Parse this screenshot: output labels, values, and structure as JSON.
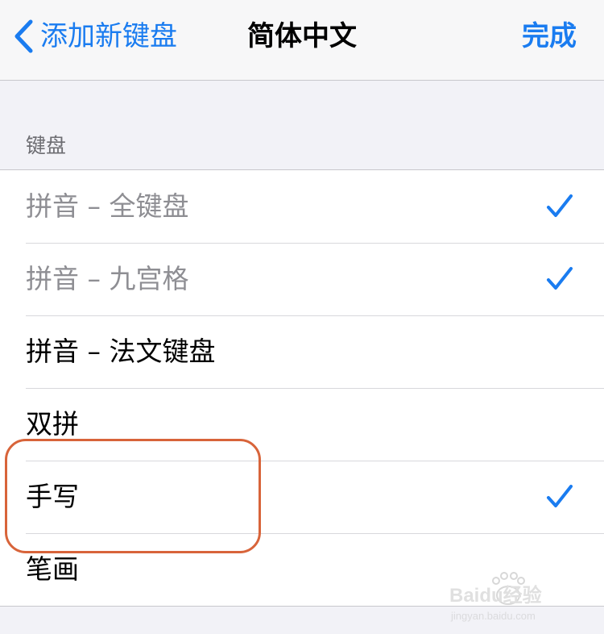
{
  "navbar": {
    "back_label": "添加新键盘",
    "title": "简体中文",
    "done_label": "完成"
  },
  "section": {
    "header": "键盘"
  },
  "keyboards": [
    {
      "label": "拼音 – 全键盘",
      "checked": true,
      "dimmed": true
    },
    {
      "label": "拼音 – 九宫格",
      "checked": true,
      "dimmed": true
    },
    {
      "label": "拼音 – 法文键盘",
      "checked": false,
      "dimmed": false
    },
    {
      "label": "双拼",
      "checked": false,
      "dimmed": false
    },
    {
      "label": "手写",
      "checked": true,
      "dimmed": false
    },
    {
      "label": "笔画",
      "checked": false,
      "dimmed": false
    }
  ],
  "watermark": {
    "brand": "Baidu经验",
    "url": "jingyan.baidu.com"
  },
  "colors": {
    "accent": "#1a7cf0",
    "highlight": "#d8643a",
    "background": "#f2f2f7"
  }
}
